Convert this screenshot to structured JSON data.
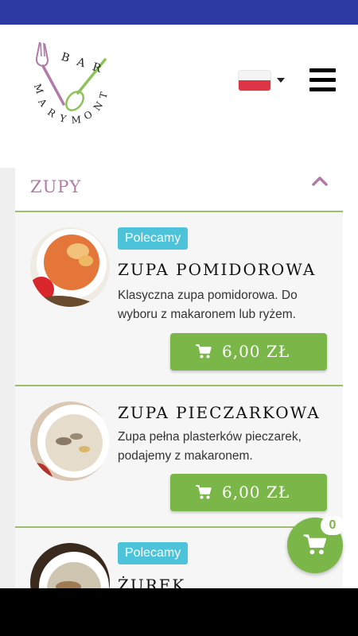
{
  "colors": {
    "status_bar": "#2e3aa3",
    "accent_green": "#7ab648",
    "section_title": "#b27aa6",
    "badge": "#4cc3d8",
    "divider": "#9bbf6a"
  },
  "header": {
    "logo": {
      "text_bar": "BAR",
      "text_name": "MARYMONT"
    },
    "language": {
      "selected": "pl",
      "icon": "poland-flag-icon"
    },
    "menu_icon": "hamburger-icon"
  },
  "section": {
    "title": "ZUPY",
    "toggle_icon": "chevron-up-icon"
  },
  "items": [
    {
      "badge": "Polecamy",
      "name": "ZUPA POMIDOROWA",
      "description": "Klasyczna zupa pomidorowa. Do wyboru z makaronem lub ryżem.",
      "price": "6,00 ZŁ"
    },
    {
      "name": "ZUPA PIECZARKOWA",
      "description": "Zupa pełna plasterków pieczarek, podajemy z makaronem.",
      "price": "6,00 ZŁ"
    },
    {
      "badge": "Polecamy",
      "name": "ŻUREK"
    }
  ],
  "cart": {
    "count": "0",
    "icon": "shopping-cart-icon"
  }
}
